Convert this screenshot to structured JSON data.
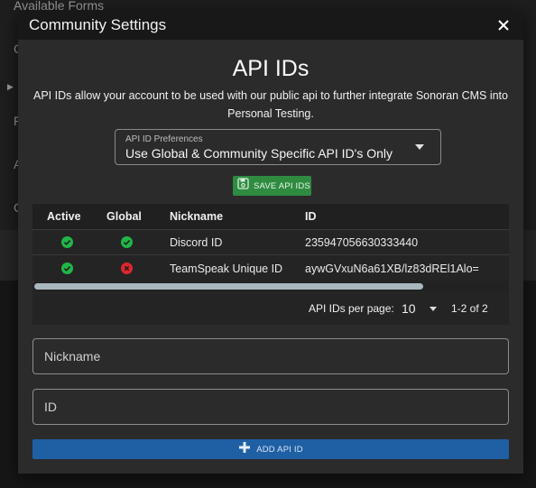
{
  "background": {
    "heading": "Available Forms",
    "side_letters": [
      "C",
      "F",
      "A",
      "C"
    ]
  },
  "modal": {
    "title": "Community Settings",
    "heading": "API IDs",
    "description": "API IDs allow your account to be used with our public api to further integrate Sonoran CMS into Personal Testing.",
    "preferences": {
      "label": "API ID Preferences",
      "value": "Use Global & Community Specific API ID's Only"
    },
    "save_label": "SAVE API IDS",
    "table": {
      "headers": [
        "Active",
        "Global",
        "Nickname",
        "ID"
      ],
      "rows": [
        {
          "active": true,
          "global": true,
          "nickname": "Discord ID",
          "id": "235947056630333440"
        },
        {
          "active": true,
          "global": false,
          "nickname": "TeamSpeak Unique ID",
          "id": "aywGVxuN6a61XB/lz83dREl1Alo="
        }
      ],
      "scroll_fraction": 0.82,
      "pager": {
        "label": "API IDs per page:",
        "value": "10",
        "range": "1-2 of 2"
      }
    },
    "nickname_placeholder": "Nickname",
    "id_placeholder": "ID",
    "add_label": "ADD API ID"
  },
  "colors": {
    "success": "#2e8b40",
    "active_icon": "#22b548",
    "inactive_icon": "#e0262c",
    "primary": "#1f5fa4"
  }
}
